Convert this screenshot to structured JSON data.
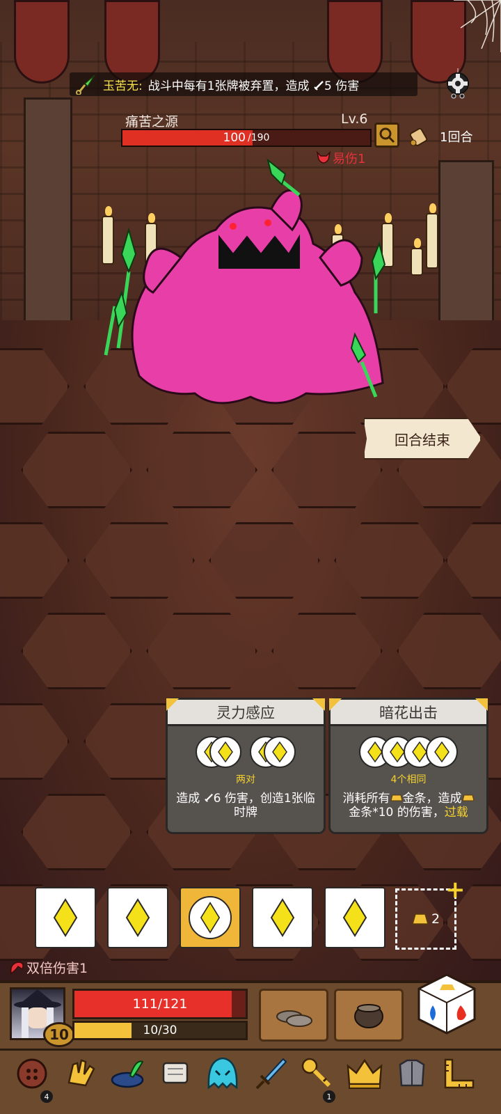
{
  "relic": {
    "name": "玉苦无:",
    "description": "战斗中每有1张牌被弃置，造成 ",
    "damage": "5 伤害"
  },
  "enemy": {
    "name": "痛苦之源",
    "level": "Lv.6",
    "hp_current": "100",
    "hp_max": "/190",
    "hp_fraction": 0.526,
    "debuff": "易伤1"
  },
  "round": {
    "label": "1回合"
  },
  "end_turn": {
    "label": "回合结束"
  },
  "skills": [
    {
      "title": "灵力感应",
      "requirement": "两对",
      "desc_prefix": "造成 ",
      "desc_damage": "6 伤害，创造1张临",
      "desc_line2": "时牌"
    },
    {
      "title": "暗花出击",
      "requirement": "4个相同",
      "desc_line1": "消耗所有",
      "desc_line1b": "金条，造成",
      "desc_line2": "金条*10 的伤害，",
      "desc_highlight": "过载"
    }
  ],
  "dice": {
    "count": 5,
    "selected_index": 2
  },
  "gold": {
    "count": "2"
  },
  "buff": {
    "label": "双倍伤害1"
  },
  "player": {
    "level": "10",
    "hp_text": "111/121",
    "hp_fraction": 0.917,
    "xp_text": "10/30",
    "xp_fraction": 0.333
  },
  "items": [
    {
      "icon": "buttons-icon",
      "count": "4"
    },
    {
      "icon": "glove-icon",
      "count": ""
    },
    {
      "icon": "feather-hat-icon",
      "count": ""
    },
    {
      "icon": "scroll-icon",
      "count": ""
    },
    {
      "icon": "ghost-icon",
      "count": ""
    },
    {
      "icon": "sword-icon",
      "count": ""
    },
    {
      "icon": "key-icon",
      "count": "1"
    },
    {
      "icon": "crown-icon",
      "count": ""
    },
    {
      "icon": "armor-icon",
      "count": ""
    },
    {
      "icon": "ruler-icon",
      "count": ""
    }
  ],
  "colors": {
    "hp_red": "#e03024",
    "gold": "#f6d22e",
    "monster_pink": "#e83ea8",
    "spear_green": "#3ad65a"
  }
}
